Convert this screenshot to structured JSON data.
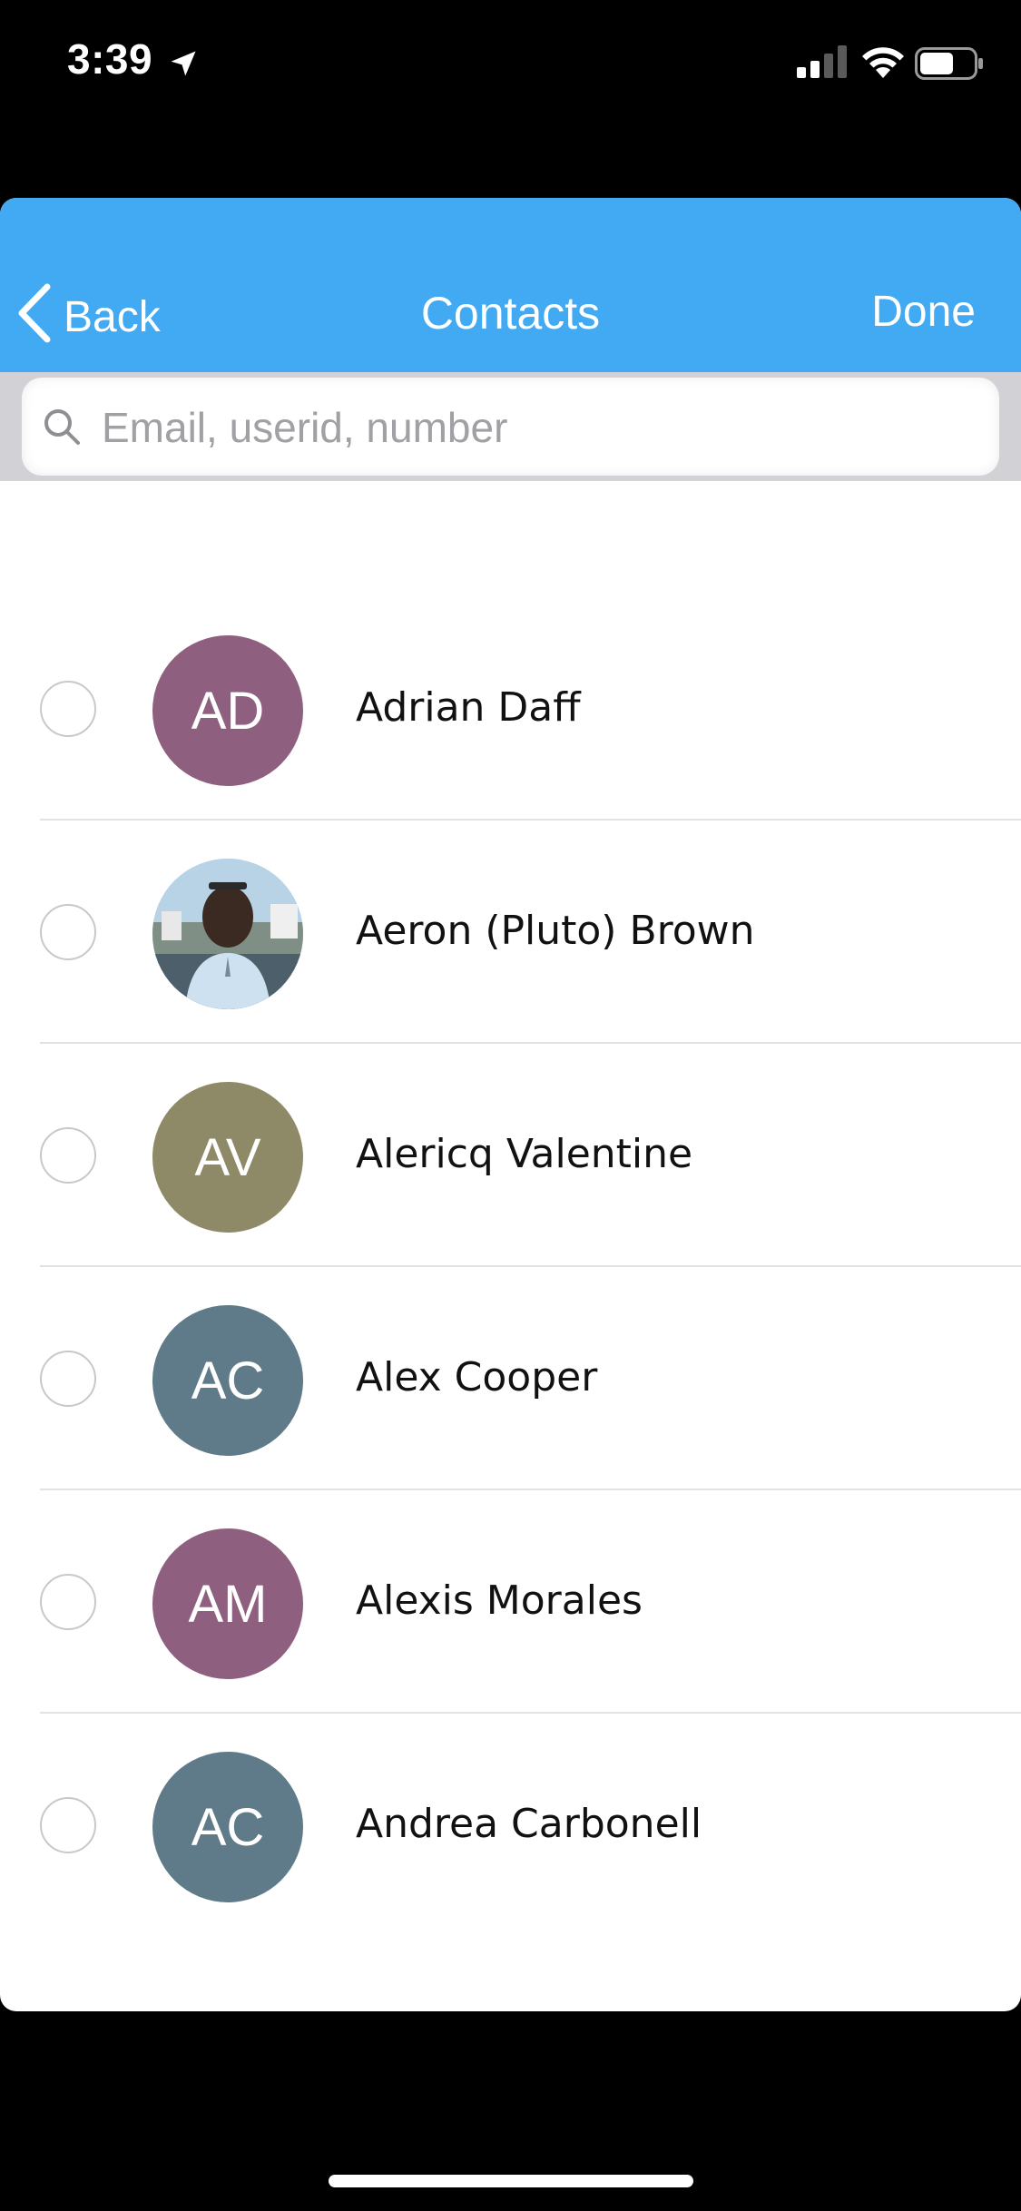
{
  "status_bar": {
    "time": "3:39",
    "location_icon": "location-arrow-icon",
    "signal_icon": "cellular-signal-icon",
    "wifi_icon": "wifi-icon",
    "battery_icon": "battery-icon"
  },
  "nav": {
    "back_label": "Back",
    "title": "Contacts",
    "done_label": "Done",
    "accent_color": "#41aaf3"
  },
  "search": {
    "placeholder": "Email, userid, number",
    "value": ""
  },
  "contacts": [
    {
      "name": "Adrian Daff",
      "initials": "AD",
      "avatar_color": "#8e5f7e",
      "selected": false
    },
    {
      "name": "Aeron (Pluto) Brown",
      "initials": "",
      "avatar_color": "#6b8fa8",
      "photo": true,
      "selected": false
    },
    {
      "name": "Alericq Valentine",
      "initials": "AV",
      "avatar_color": "#8e8966",
      "selected": false
    },
    {
      "name": "Alex Cooper",
      "initials": "AC",
      "avatar_color": "#5f7a88",
      "selected": false
    },
    {
      "name": "Alexis Morales",
      "initials": "AM",
      "avatar_color": "#8e5f7e",
      "selected": false
    },
    {
      "name": "Andrea Carbonell",
      "initials": "AC",
      "avatar_color": "#5f7a88",
      "selected": false
    }
  ]
}
